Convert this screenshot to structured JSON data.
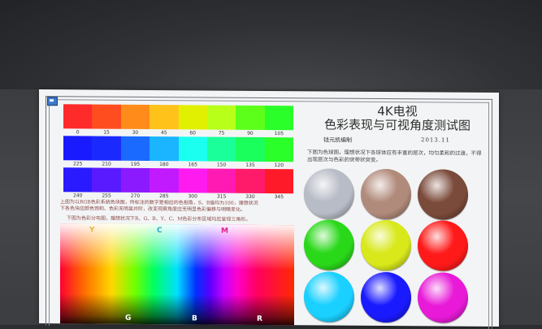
{
  "scene": {
    "wall_color": "#3a3b3e",
    "screen_color": "#f3f4f5"
  },
  "chart": {
    "title_line1": "4K电视",
    "title_line2": "色彩表现与可视角度测试图",
    "author": "钱元凯编制",
    "date": "2013.11",
    "strip1": {
      "colors": [
        "#ff2a2a",
        "#ff4d1f",
        "#ff8c1a",
        "#ffc21a",
        "#e0f000",
        "#b8ff1a",
        "#5cff1a",
        "#2aff2a"
      ],
      "labels": [
        "0",
        "15",
        "30",
        "45",
        "60",
        "75",
        "90",
        "105"
      ]
    },
    "strip2": {
      "colors": [
        "#1a1aff",
        "#1a2aff",
        "#1a6aff",
        "#1ab4ff",
        "#1afff0",
        "#1aff9a",
        "#1aff5c",
        "#2aff2a"
      ],
      "labels": [
        "225",
        "210",
        "195",
        "180",
        "165",
        "150",
        "135",
        "120"
      ]
    },
    "strip3": {
      "colors": [
        "#2a1aff",
        "#5a1aff",
        "#8c1aff",
        "#c21aff",
        "#ff1af0",
        "#ff1ab4",
        "#ff1a6a",
        "#ff1a2a"
      ],
      "labels": [
        "240",
        "255",
        "270",
        "285",
        "300",
        "315",
        "330",
        "345"
      ]
    },
    "desc_line1": "上图为以RGB色彩系统色块图，所标注的数字是相应的色相角，S、B值均为100，理想状况",
    "desc_line2": "下各色块应颜色饱和、色彩无明显并阶，改变观察角度应无明显色彩偏移与明暗变化。",
    "desc_line3": "下图为色彩分布图，理想状况下R、G、B、Y、C、M色彩分布区域均应呈现三角形。",
    "hue_letters": {
      "y": "Y",
      "c": "C",
      "m": "M",
      "g": "G",
      "b": "B",
      "r": "R"
    },
    "ball_desc": "下图为色球图，理想状况下各球体应有丰富的层次，均匀柔和的过渡，不得出现层次与色彩的突带状突变。",
    "balls": [
      {
        "name": "silver-gray",
        "color": "#b8bcc6"
      },
      {
        "name": "skin-tan",
        "color": "#b08a7a"
      },
      {
        "name": "dark-brown",
        "color": "#7a4a3a"
      },
      {
        "name": "green",
        "color": "#2ad81a"
      },
      {
        "name": "yellow-green",
        "color": "#d8e81a"
      },
      {
        "name": "red",
        "color": "#ff1a1a"
      },
      {
        "name": "cyan",
        "color": "#1ad0ff"
      },
      {
        "name": "blue",
        "color": "#1a1aff"
      },
      {
        "name": "magenta",
        "color": "#e81ad8"
      }
    ]
  }
}
